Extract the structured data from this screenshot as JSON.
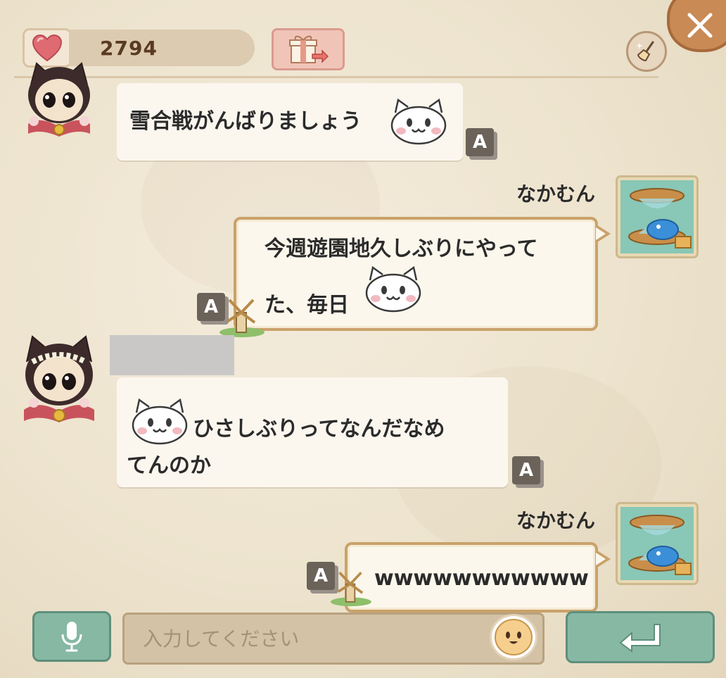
{
  "header": {
    "heart_count": "2794",
    "heart_icon": "heart-icon",
    "gift_icon": "gift-send-icon",
    "clean_icon": "broom-sparkle-icon",
    "close_icon": "close-icon"
  },
  "messages": [
    {
      "side": "left",
      "text": "雪合戦がんばりましょう",
      "badge": "A"
    },
    {
      "side": "right",
      "sender": "なかむん",
      "line1": "今週遊園地久しぶりにやって",
      "line2": "た、毎日",
      "badge": "A"
    },
    {
      "side": "left",
      "line1": "ひさしぶりってなんだなめ",
      "line2": "てんのか",
      "badge": "A"
    },
    {
      "side": "right",
      "sender": "なかむん",
      "text": "wwwwwwwwwww",
      "badge": "A"
    }
  ],
  "input": {
    "placeholder": "入力してください",
    "mic_icon": "microphone-icon",
    "emoji_icon": "smile-face-icon",
    "enter_icon": "enter-arrow-icon"
  },
  "colors": {
    "background": "#efe6d3",
    "accent_green": "#86b8a4",
    "bubble_border": "#c9a26a",
    "gift_pink": "#f1c4b8"
  }
}
